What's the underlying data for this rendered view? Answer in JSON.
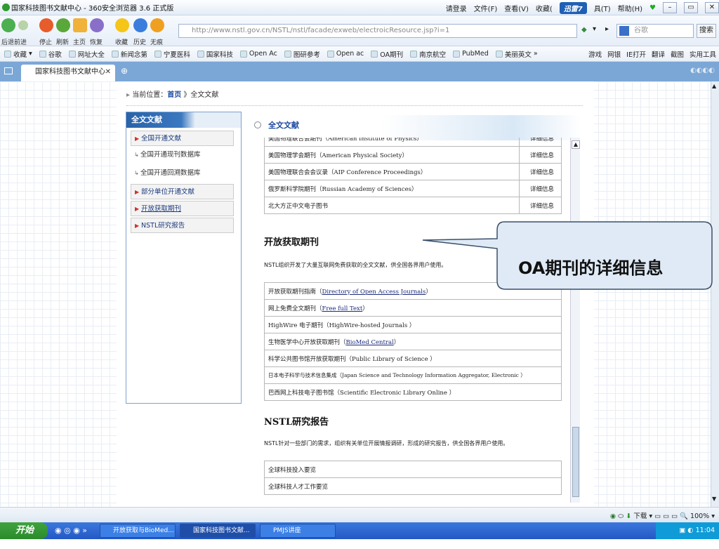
{
  "window": {
    "title": "国家科技图书文献中心 - 360安全浏览器 3.6 正式版",
    "menu": [
      "请登录",
      "文件(F)",
      "查看(V)",
      "收藏(",
      "迅雷7",
      "具(T)",
      "帮助(H)"
    ]
  },
  "toolbar": {
    "labels": [
      "后退",
      "前进",
      "停止",
      "刷新",
      "主页",
      "恢复",
      "收藏",
      "历史",
      "无痕"
    ],
    "address": "http://www.nstl.gov.cn/NSTL/nstl/facade/exweb/electroicResource.jsp?i=1",
    "address_host": "nstl.gov.cn",
    "search_placeholder": "谷歌",
    "search_button": "搜索"
  },
  "favorites": {
    "items": [
      "收藏",
      "谷歌",
      "网址大全",
      "新闻念第",
      "宁夏医科",
      "国家科技",
      "Open Ac",
      "图研参考",
      "Open ac",
      "OA期刊",
      "南京航空",
      "PubMed",
      "美丽英文"
    ],
    "right": [
      "游戏",
      "网银",
      "IE打开",
      "翻译",
      "截图",
      "实用工具"
    ]
  },
  "tab": {
    "label": "国家科技图书文献中心"
  },
  "page": {
    "breadcrumb_prefix": "当前位置：",
    "breadcrumb_home": "首页",
    "breadcrumb_tail": "》全文文献",
    "leftnav": {
      "title": "全文文献",
      "items": [
        "全国开通文献",
        "全国开通现刊数据库",
        "全国开通回溯数据库",
        "部分单位开通文献",
        "开放获取期刊",
        "NSTL研究报告"
      ]
    },
    "main_title": "全文文献",
    "top_table": [
      {
        "name": "美国物理联合会期刊（American Institute of Physics）",
        "detail": "详细信息"
      },
      {
        "name": "美国物理学会期刊（American Physical Society）",
        "detail": "详细信息"
      },
      {
        "name": "美国物理联合会会议录（AIP Conference Proceedings）",
        "detail": "详细信息"
      },
      {
        "name": "俄罗斯科学院期刊（Russian Academy of Sciences）",
        "detail": "详细信息"
      },
      {
        "name": "北大方正中文电子图书",
        "detail": "详细信息"
      }
    ],
    "oa": {
      "title": "开放获取期刊",
      "desc": "NSTL组织开发了大量互联网免费获取的全文文献，供全国各界用户使用。",
      "rows": [
        {
          "pre": "开放获取期刊指南（",
          "link": "Directory of Open Access Journals",
          "post": "）"
        },
        {
          "pre": "网上免费全文期刊（",
          "link": "Free full Text",
          "post": "）"
        },
        {
          "pre": "HighWire 电子期刊（HighWire-hosted Journals ）",
          "link": "",
          "post": ""
        },
        {
          "pre": "生物医学中心开放获取期刊（",
          "link": "BioMed Central",
          "post": "）"
        },
        {
          "pre": "科学公共图书馆开放获取期刊（Public Library of Science ）",
          "link": "",
          "post": ""
        },
        {
          "pre": "日本电子科学与技术信息集成（Japan Science and Technology Information Aggregator, Electronic ）",
          "link": "",
          "post": ""
        },
        {
          "pre": "巴西网上科技电子图书馆（Scientific Electronic Library Online ）",
          "link": "",
          "post": ""
        }
      ]
    },
    "report": {
      "title": "NSTL研究报告",
      "desc": "NSTL针对一些部门的需求，组织有关单位开展情报调研，形成的研究报告，供全国各界用户使用。",
      "rows": [
        "全球科技投入要览",
        "全球科技人才工作要览"
      ]
    }
  },
  "callout": {
    "text": "OA期刊的详细信息"
  },
  "statusbar": {
    "download": "下载",
    "zoom": "100%"
  },
  "taskbar": {
    "start": "开始",
    "tasks": [
      "开放获取与BioMed...",
      "国家科技图书文献...",
      "PMJS讲座"
    ],
    "clock": "11:04"
  }
}
